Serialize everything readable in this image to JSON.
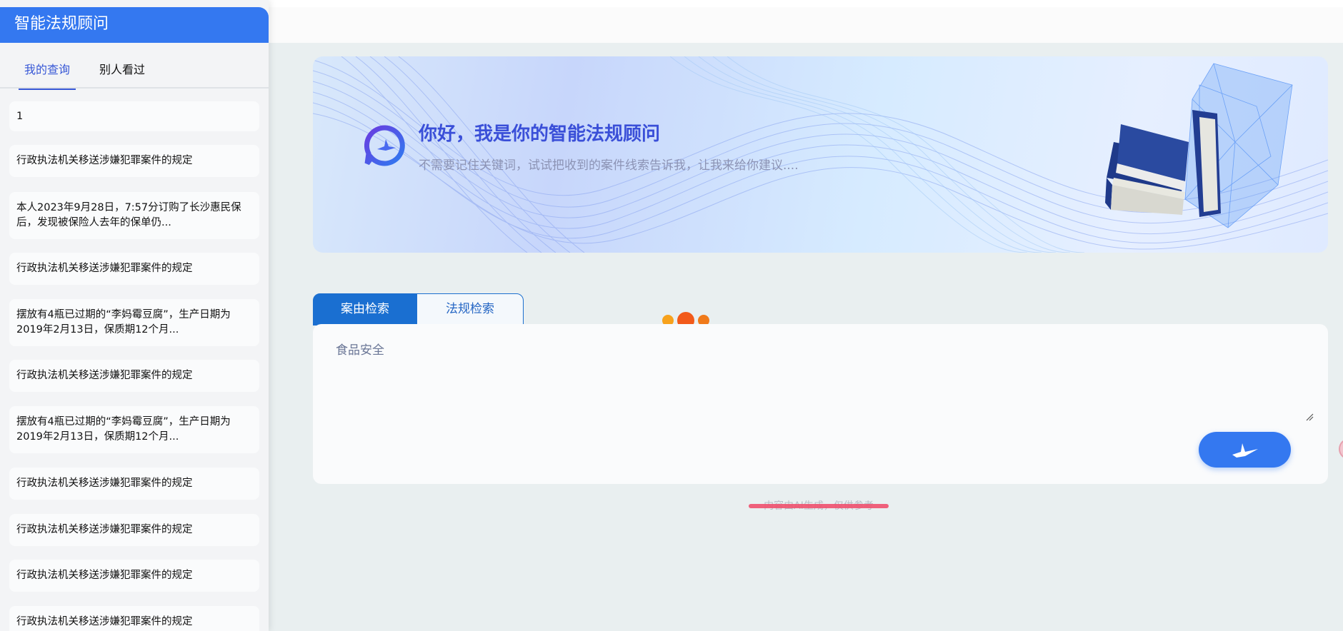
{
  "app": {
    "title": "智能法规顾问"
  },
  "sidebar": {
    "tabs": [
      {
        "label": "我的查询",
        "active": true
      },
      {
        "label": "别人看过",
        "active": false
      }
    ],
    "items": [
      {
        "text": "1"
      },
      {
        "text": "行政执法机关移送涉嫌犯罪案件的规定"
      },
      {
        "text": "本人2023年9月28日，7:57分订购了长沙惠民保后，发现被保险人去年的保单仍..."
      },
      {
        "text": "行政执法机关移送涉嫌犯罪案件的规定"
      },
      {
        "text": "摆放有4瓶已过期的“李妈霉豆腐”，生产日期为2019年2月13日，保质期12个月..."
      },
      {
        "text": "行政执法机关移送涉嫌犯罪案件的规定"
      },
      {
        "text": "摆放有4瓶已过期的“李妈霉豆腐”，生产日期为2019年2月13日，保质期12个月..."
      },
      {
        "text": "行政执法机关移送涉嫌犯罪案件的规定"
      },
      {
        "text": "行政执法机关移送涉嫌犯罪案件的规定"
      },
      {
        "text": "行政执法机关移送涉嫌犯罪案件的规定"
      },
      {
        "text": "行政执法机关移送涉嫌犯罪案件的规定"
      }
    ]
  },
  "banner": {
    "title": "你好，我是你的智能法规顾问",
    "subtitle": "不需要记住关键词，试试把收到的案件线索告诉我，让我来给你建议...."
  },
  "search": {
    "tabs": [
      {
        "label": "案由检索",
        "active": true
      },
      {
        "label": "法规检索",
        "active": false
      }
    ],
    "input_value": "食品安全"
  },
  "footer": {
    "ai_note": "内容由AI生成，仅供参考"
  },
  "colors": {
    "brand": "#3478f0",
    "tab_active": "#1a6fd1",
    "title": "#3a4fd8",
    "strike": "#f0506e"
  },
  "icons": {
    "logo": "chat-bubble-bird-icon",
    "send": "bird-send-icon",
    "loading": "loading-dots-icon",
    "resize": "resize-grip-icon",
    "illustration": "law-books-illustration"
  }
}
